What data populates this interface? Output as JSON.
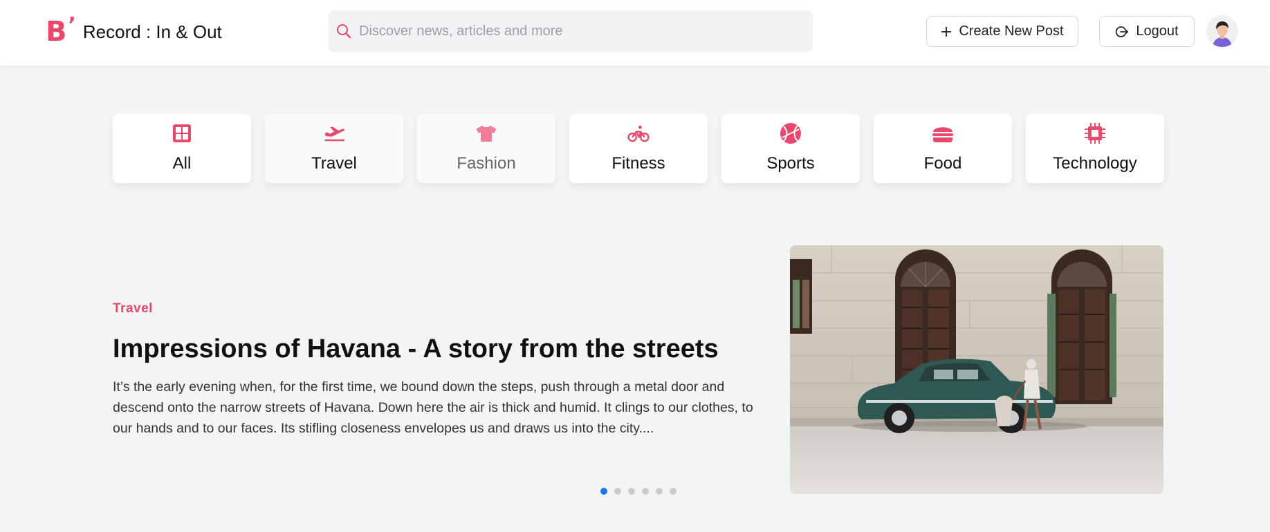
{
  "header": {
    "brand": {
      "logo_letter": "B",
      "logo_mark": "’",
      "title": "Record : In & Out"
    },
    "search": {
      "placeholder": "Discover news, articles and more",
      "value": "",
      "icon": "search-icon"
    },
    "create_button": {
      "label": "Create New Post",
      "icon": "plus-icon"
    },
    "logout_button": {
      "label": "Logout",
      "icon": "logout-icon"
    },
    "avatar": {
      "icon": "user-avatar"
    }
  },
  "categories": [
    {
      "label": "All",
      "icon": "grid-icon"
    },
    {
      "label": "Travel",
      "icon": "plane-departure-icon"
    },
    {
      "label": "Fashion",
      "icon": "tshirt-icon"
    },
    {
      "label": "Fitness",
      "icon": "bicycle-icon"
    },
    {
      "label": "Sports",
      "icon": "ball-icon"
    },
    {
      "label": "Food",
      "icon": "burger-icon"
    },
    {
      "label": "Technology",
      "icon": "chip-icon"
    }
  ],
  "featured": {
    "category": "Travel",
    "title": "Impressions of Havana - A story from the streets",
    "excerpt": "It’s the early evening when, for the first time, we bound down the steps, push through a metal door and descend onto the narrow streets of Havana. Down here the air is thick and humid. It clings to our clothes, to our hands and to our faces. Its stifling closeness envelopes us and draws us into the city....",
    "slide_count": 6,
    "active_slide": 1
  },
  "colors": {
    "accent": "#e8486b",
    "active_dot": "#1877f2",
    "page_background": "#f3f4f6"
  }
}
